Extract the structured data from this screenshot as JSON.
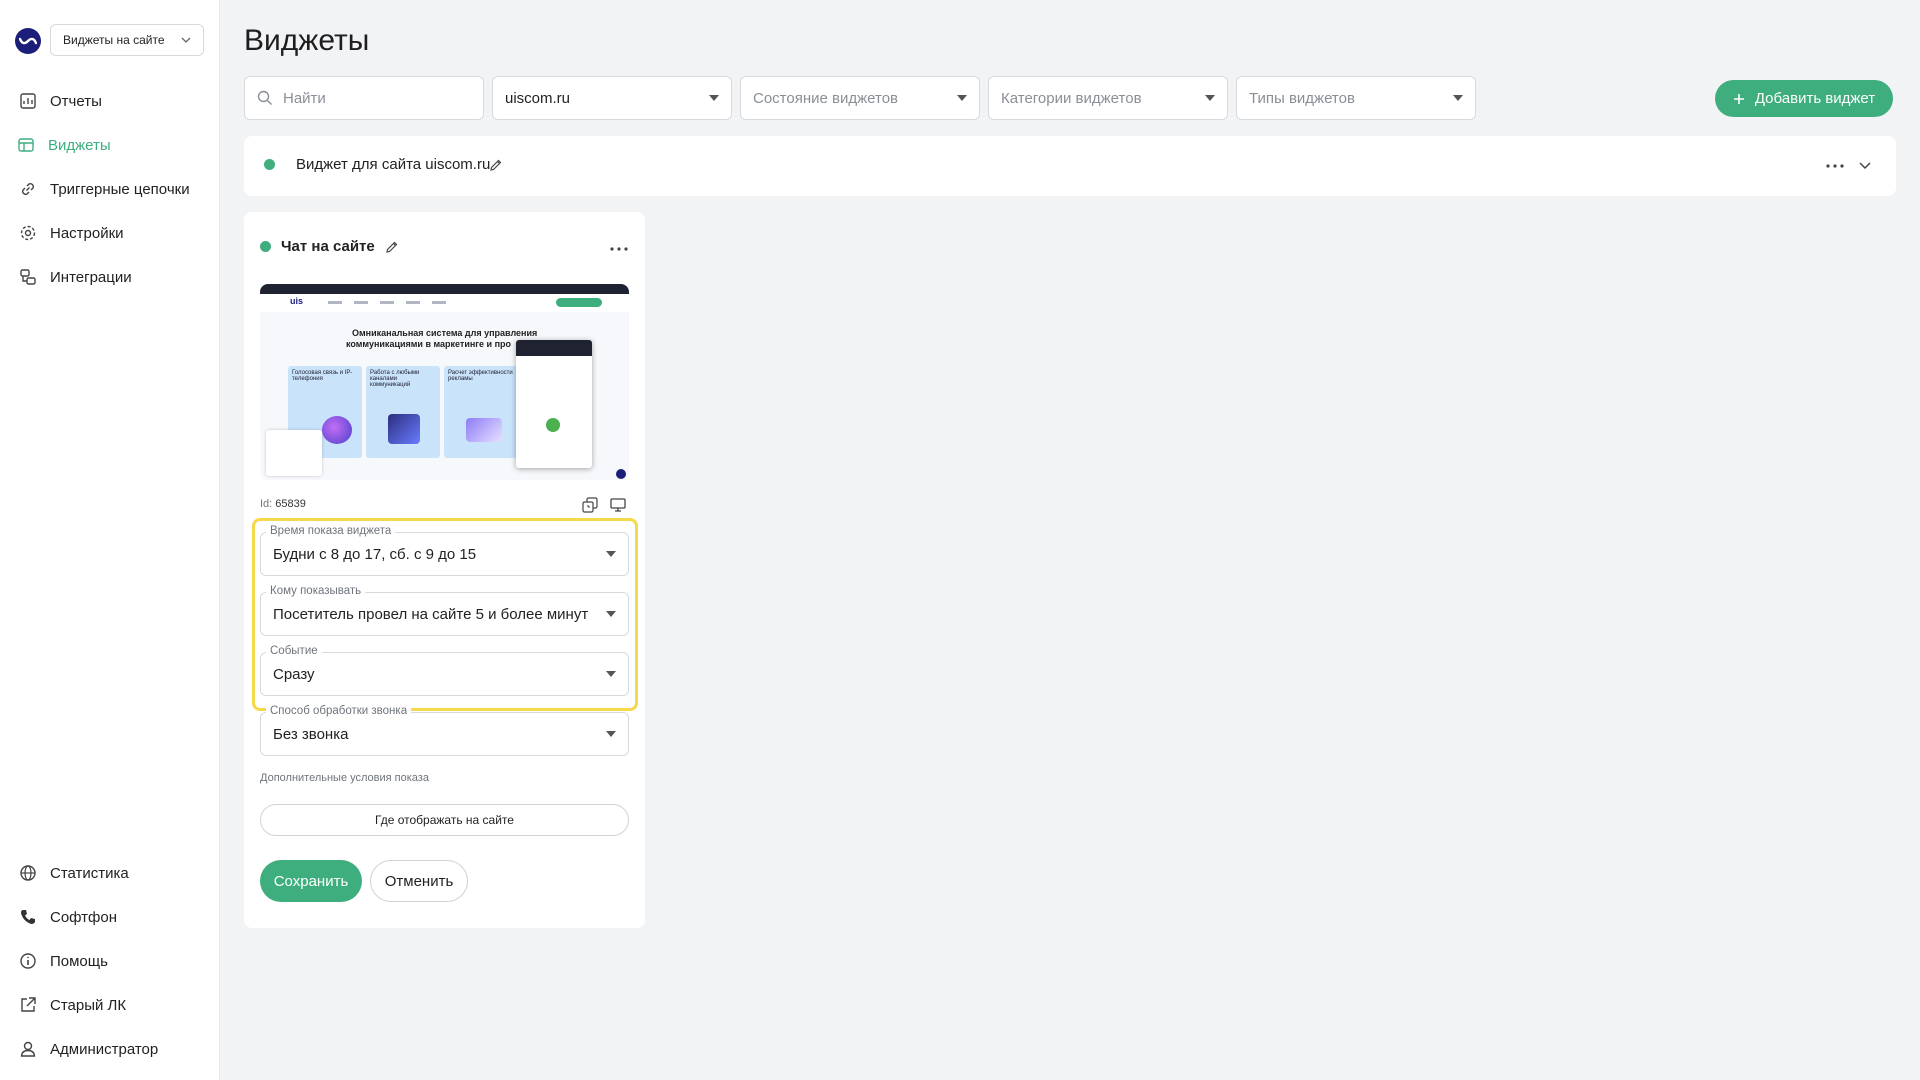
{
  "sidebar": {
    "app_select": "Виджеты на сайте",
    "top_items": [
      {
        "label": "Отчеты",
        "icon": "reports-icon"
      },
      {
        "label": "Виджеты",
        "icon": "widgets-icon"
      },
      {
        "label": "Триггерные цепочки",
        "icon": "chain-icon"
      },
      {
        "label": "Настройки",
        "icon": "gear-icon"
      },
      {
        "label": "Интеграции",
        "icon": "integrations-icon"
      }
    ],
    "bottom_items": [
      {
        "label": "Статистика",
        "icon": "globe-icon"
      },
      {
        "label": "Софтфон",
        "icon": "phone-icon"
      },
      {
        "label": "Помощь",
        "icon": "info-icon"
      },
      {
        "label": "Старый ЛК",
        "icon": "external-link-icon"
      },
      {
        "label": "Администратор",
        "icon": "user-icon"
      }
    ]
  },
  "header": {
    "title": "Виджеты",
    "search_placeholder": "Найти",
    "site_value": "uiscom.ru",
    "state_placeholder": "Состояние виджетов",
    "category_placeholder": "Категории виджетов",
    "types_placeholder": "Типы виджетов",
    "add_label": "Добавить виджет"
  },
  "group": {
    "title": "Виджет для сайта uiscom.ru"
  },
  "card": {
    "title": "Чат на сайте",
    "id_label": "Id:",
    "id_value": "65839",
    "fields": [
      {
        "label": "Время показа виджета",
        "value": "Будни с 8 до 17, сб. с 9 до 15"
      },
      {
        "label": "Кому показывать",
        "value": "Посетитель провел на сайте 5 и более минут"
      },
      {
        "label": "Событие",
        "value": "Сразу"
      },
      {
        "label": "Способ обработки звонка",
        "value": "Без звонка"
      }
    ],
    "extra_conditions": "Дополнительные условия показа",
    "where_button": "Где отображать на сайте",
    "save": "Сохранить",
    "cancel": "Отменить"
  },
  "preview": {
    "logo": "uis",
    "headline_1": "Омниканальная система для управления",
    "headline_2": "коммуникациями в маркетинге и про",
    "tiles": [
      "Голосовая связь и IP-телефония",
      "Работа с любыми каналами коммуникаций",
      "Расчет эффективности рекламы"
    ]
  },
  "colors": {
    "accent": "#3fae7e",
    "highlight": "#f5d94a",
    "logo": "#1c1f7a"
  }
}
